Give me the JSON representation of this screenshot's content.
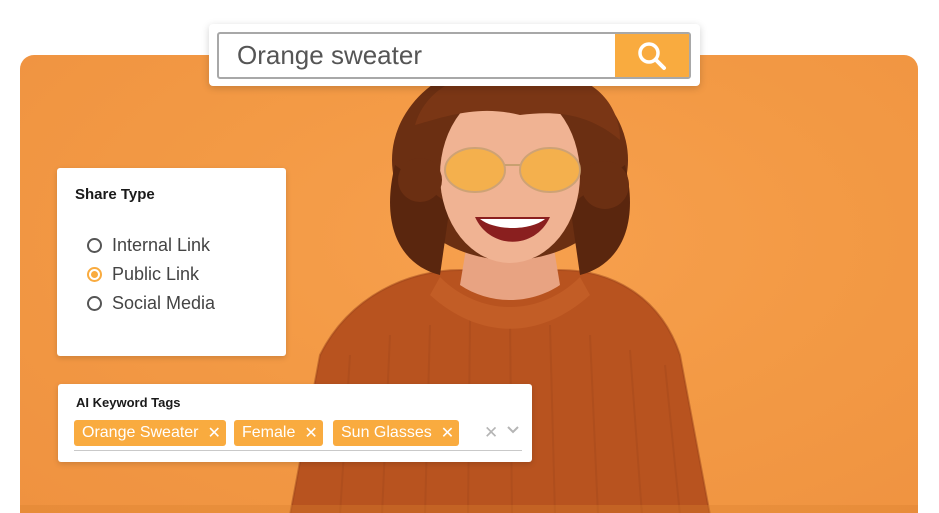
{
  "search": {
    "value": "Orange sweater",
    "icon": "search-icon"
  },
  "share_type": {
    "title": "Share Type",
    "options": [
      {
        "label": "Internal Link",
        "selected": false
      },
      {
        "label": "Public Link",
        "selected": true
      },
      {
        "label": "Social Media",
        "selected": false
      }
    ]
  },
  "keyword_tags": {
    "title": "AI Keyword Tags",
    "tags": [
      {
        "label": "Orange Sweater"
      },
      {
        "label": "Female"
      },
      {
        "label": "Sun Glasses"
      }
    ],
    "clear_icon": "clear-icon",
    "dropdown_icon": "chevron-down-icon"
  },
  "colors": {
    "accent": "#f9ab3f",
    "background_orange": "#f39a45",
    "sweater": "#b8531f"
  }
}
